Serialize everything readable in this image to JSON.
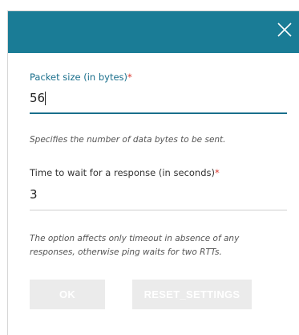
{
  "dialog": {
    "close_icon": "close-icon",
    "header_color": "#1a7c96"
  },
  "packet_size": {
    "label": "Packet size (in bytes)",
    "required_mark": "*",
    "value": "56",
    "hint": "Specifies the number of data bytes to be sent."
  },
  "timeout": {
    "label": "Time to wait for a response (in seconds)",
    "required_mark": "*",
    "value": "3",
    "hint": "The option affects only timeout in absence of any responses, otherwise ping waits for two RTTs."
  },
  "buttons": {
    "ok_label": "OK",
    "reset_label": "RESET_SETTINGS"
  }
}
